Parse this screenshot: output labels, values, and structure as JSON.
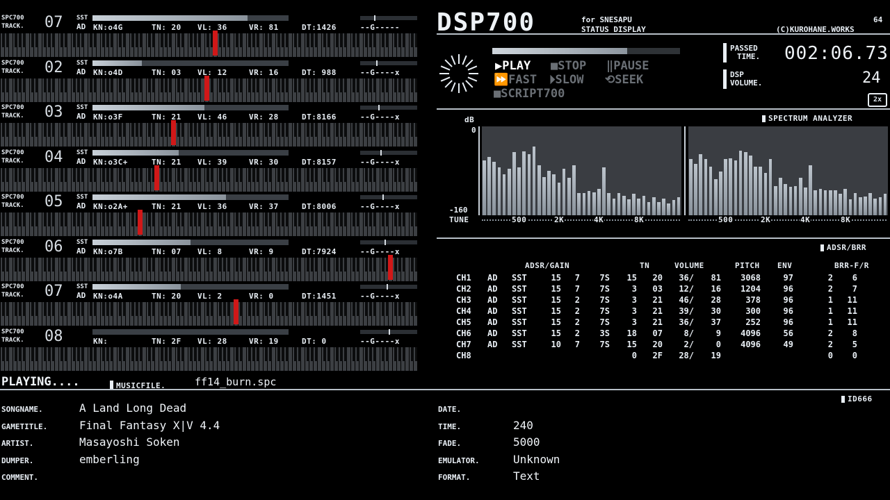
{
  "tracks": [
    {
      "spc": "SPC700",
      "track": "TRACK.",
      "num": "07",
      "sst": "SST",
      "ad": "AD",
      "kn": "KN:o4G",
      "tn": "TN: 20",
      "vl": "VL: 36",
      "vr": "VR: 81",
      "dt": "DT:1426",
      "env": "--G-----",
      "progress": 0.79,
      "note": 0.51
    },
    {
      "spc": "SPC700",
      "track": "TRACK.",
      "num": "02",
      "sst": "SST",
      "ad": "AD",
      "kn": "KN:o4D",
      "tn": "TN: 03",
      "vl": "VL: 12",
      "vr": "VR: 16",
      "dt": "DT: 988",
      "env": "--G----x",
      "progress": 0.25,
      "note": 0.49
    },
    {
      "spc": "SPC700",
      "track": "TRACK.",
      "num": "03",
      "sst": "SST",
      "ad": "AD",
      "kn": "KN:o3F",
      "tn": "TN: 21",
      "vl": "VL: 46",
      "vr": "VR: 28",
      "dt": "DT:8166",
      "env": "--G----x",
      "progress": 0.57,
      "note": 0.41
    },
    {
      "spc": "SPC700",
      "track": "TRACK.",
      "num": "04",
      "sst": "SST",
      "ad": "AD",
      "kn": "KN:o3C+",
      "tn": "TN: 21",
      "vl": "VL: 39",
      "vr": "VR: 30",
      "dt": "DT:8157",
      "env": "--G----x",
      "progress": 0.44,
      "note": 0.37
    },
    {
      "spc": "SPC700",
      "track": "TRACK.",
      "num": "05",
      "sst": "SST",
      "ad": "AD",
      "kn": "KN:o2A+",
      "tn": "TN: 21",
      "vl": "VL: 36",
      "vr": "VR: 37",
      "dt": "DT:8006",
      "env": "--G----x",
      "progress": 0.68,
      "note": 0.33
    },
    {
      "spc": "SPC700",
      "track": "TRACK.",
      "num": "06",
      "sst": "SST",
      "ad": "AD",
      "kn": "KN:o7B",
      "tn": "TN: 07",
      "vl": "VL:  8",
      "vr": "VR:  9",
      "dt": "DT:7924",
      "env": "--G----x",
      "progress": 0.5,
      "note": 0.93
    },
    {
      "spc": "SPC700",
      "track": "TRACK.",
      "num": "07",
      "sst": "SST",
      "ad": "AD",
      "kn": "KN:o4A",
      "tn": "TN: 20",
      "vl": "VL:  2",
      "vr": "VR:  0",
      "dt": "DT:1451",
      "env": "--G----x",
      "progress": 0.45,
      "note": 0.56
    },
    {
      "spc": "SPC700",
      "track": "TRACK.",
      "num": "08",
      "sst": "",
      "ad": "",
      "kn": "KN:",
      "tn": "TN: 2F",
      "vl": "VL: 28",
      "vr": "VR: 19",
      "dt": "DT:   0",
      "env": "--G----x",
      "progress": 0.0,
      "note": -1
    }
  ],
  "playing": {
    "label": "PLAYING....",
    "musicfile_label": "MUSICFILE.",
    "musicfile": "ff14_burn.spc"
  },
  "header": {
    "logo": "DSP700",
    "for": "for SNESAPU",
    "subtitle": "STATUS DISPLAY",
    "version": "64",
    "credit": "(C)KUROHANE.WORKS"
  },
  "controls": {
    "play": "PLAY",
    "stop": "STOP",
    "pause": "PAUSE",
    "fast": "FAST",
    "slow": "SLOW",
    "seek": "SEEK",
    "script": "SCRIPT700",
    "seek_progress": 0.72
  },
  "status": {
    "passed_label1": "PASSED",
    "passed_label2": "TIME.",
    "passed_time": "002:06.73",
    "volume_label1": "DSP",
    "volume_label2": "VOLUME.",
    "volume": "24",
    "zoom": "2x"
  },
  "spectrum": {
    "title": "SPECTRUM ANALYZER",
    "db_label": "dB",
    "db_top": "0",
    "db_bottom": "-160",
    "tune_label": "TUNE",
    "ticks": [
      "500",
      "2K",
      "4K",
      "8K"
    ],
    "left": [
      0.62,
      0.66,
      0.6,
      0.54,
      0.46,
      0.52,
      0.71,
      0.54,
      0.72,
      0.69,
      0.77,
      0.56,
      0.43,
      0.5,
      0.46,
      0.37,
      0.52,
      0.42,
      0.56,
      0.25,
      0.25,
      0.27,
      0.26,
      0.3,
      0.54,
      0.25,
      0.19,
      0.25,
      0.22,
      0.18,
      0.24,
      0.19,
      0.22,
      0.15,
      0.2,
      0.15,
      0.19,
      0.13,
      0.17,
      0.2
    ],
    "right": [
      0.63,
      0.58,
      0.69,
      0.63,
      0.55,
      0.41,
      0.49,
      0.63,
      0.64,
      0.62,
      0.73,
      0.71,
      0.67,
      0.55,
      0.55,
      0.48,
      0.63,
      0.33,
      0.42,
      0.35,
      0.32,
      0.33,
      0.42,
      0.31,
      0.56,
      0.28,
      0.3,
      0.28,
      0.28,
      0.28,
      0.24,
      0.3,
      0.18,
      0.25,
      0.2,
      0.21,
      0.25,
      0.19,
      0.2,
      0.24
    ]
  },
  "adsr": {
    "title": "ADSR/BRR",
    "headers": {
      "adsr": "ADSR/GAIN",
      "tn": "TN",
      "volume": "VOLUME",
      "pitch": "PITCH",
      "env": "ENV",
      "brr": "BRR-F/R"
    },
    "rows": [
      [
        "CH1",
        "AD",
        "SST",
        "15",
        "7",
        "7S",
        "15",
        "20",
        "36/",
        "81",
        "3068",
        "97",
        "2",
        "6"
      ],
      [
        "CH2",
        "AD",
        "SST",
        "15",
        "7",
        "7S",
        "3",
        "03",
        "12/",
        "16",
        "1204",
        "96",
        "2",
        "7"
      ],
      [
        "CH3",
        "AD",
        "SST",
        "15",
        "2",
        "7S",
        "3",
        "21",
        "46/",
        "28",
        "378",
        "96",
        "1",
        "11"
      ],
      [
        "CH4",
        "AD",
        "SST",
        "15",
        "2",
        "7S",
        "3",
        "21",
        "39/",
        "30",
        "300",
        "96",
        "1",
        "11"
      ],
      [
        "CH5",
        "AD",
        "SST",
        "15",
        "2",
        "7S",
        "3",
        "21",
        "36/",
        "37",
        "252",
        "96",
        "1",
        "11"
      ],
      [
        "CH6",
        "AD",
        "SST",
        "15",
        "2",
        "3S",
        "18",
        "07",
        "8/",
        "9",
        "4096",
        "56",
        "2",
        "8"
      ],
      [
        "CH7",
        "AD",
        "SST",
        "10",
        "7",
        "7S",
        "15",
        "20",
        "2/",
        "0",
        "4096",
        "49",
        "2",
        "5"
      ],
      [
        "CH8",
        "",
        "",
        "",
        "",
        "",
        "0",
        "2F",
        "28/",
        "19",
        "",
        "",
        "0",
        "0"
      ]
    ]
  },
  "meta": {
    "id": "ID666",
    "left": [
      {
        "k": "SONGNAME.",
        "v": "A Land Long Dead"
      },
      {
        "k": "GAMETITLE.",
        "v": "Final Fantasy X|V 4.4"
      },
      {
        "k": "ARTIST.",
        "v": "Masayoshi Soken"
      },
      {
        "k": "DUMPER.",
        "v": "emberling"
      },
      {
        "k": "COMMENT.",
        "v": ""
      }
    ],
    "right": [
      {
        "k": "DATE.",
        "v": ""
      },
      {
        "k": "TIME.",
        "v": "240"
      },
      {
        "k": "FADE.",
        "v": "5000"
      },
      {
        "k": "EMULATOR.",
        "v": "Unknown"
      },
      {
        "k": "FORMAT.",
        "v": "Text"
      }
    ]
  }
}
